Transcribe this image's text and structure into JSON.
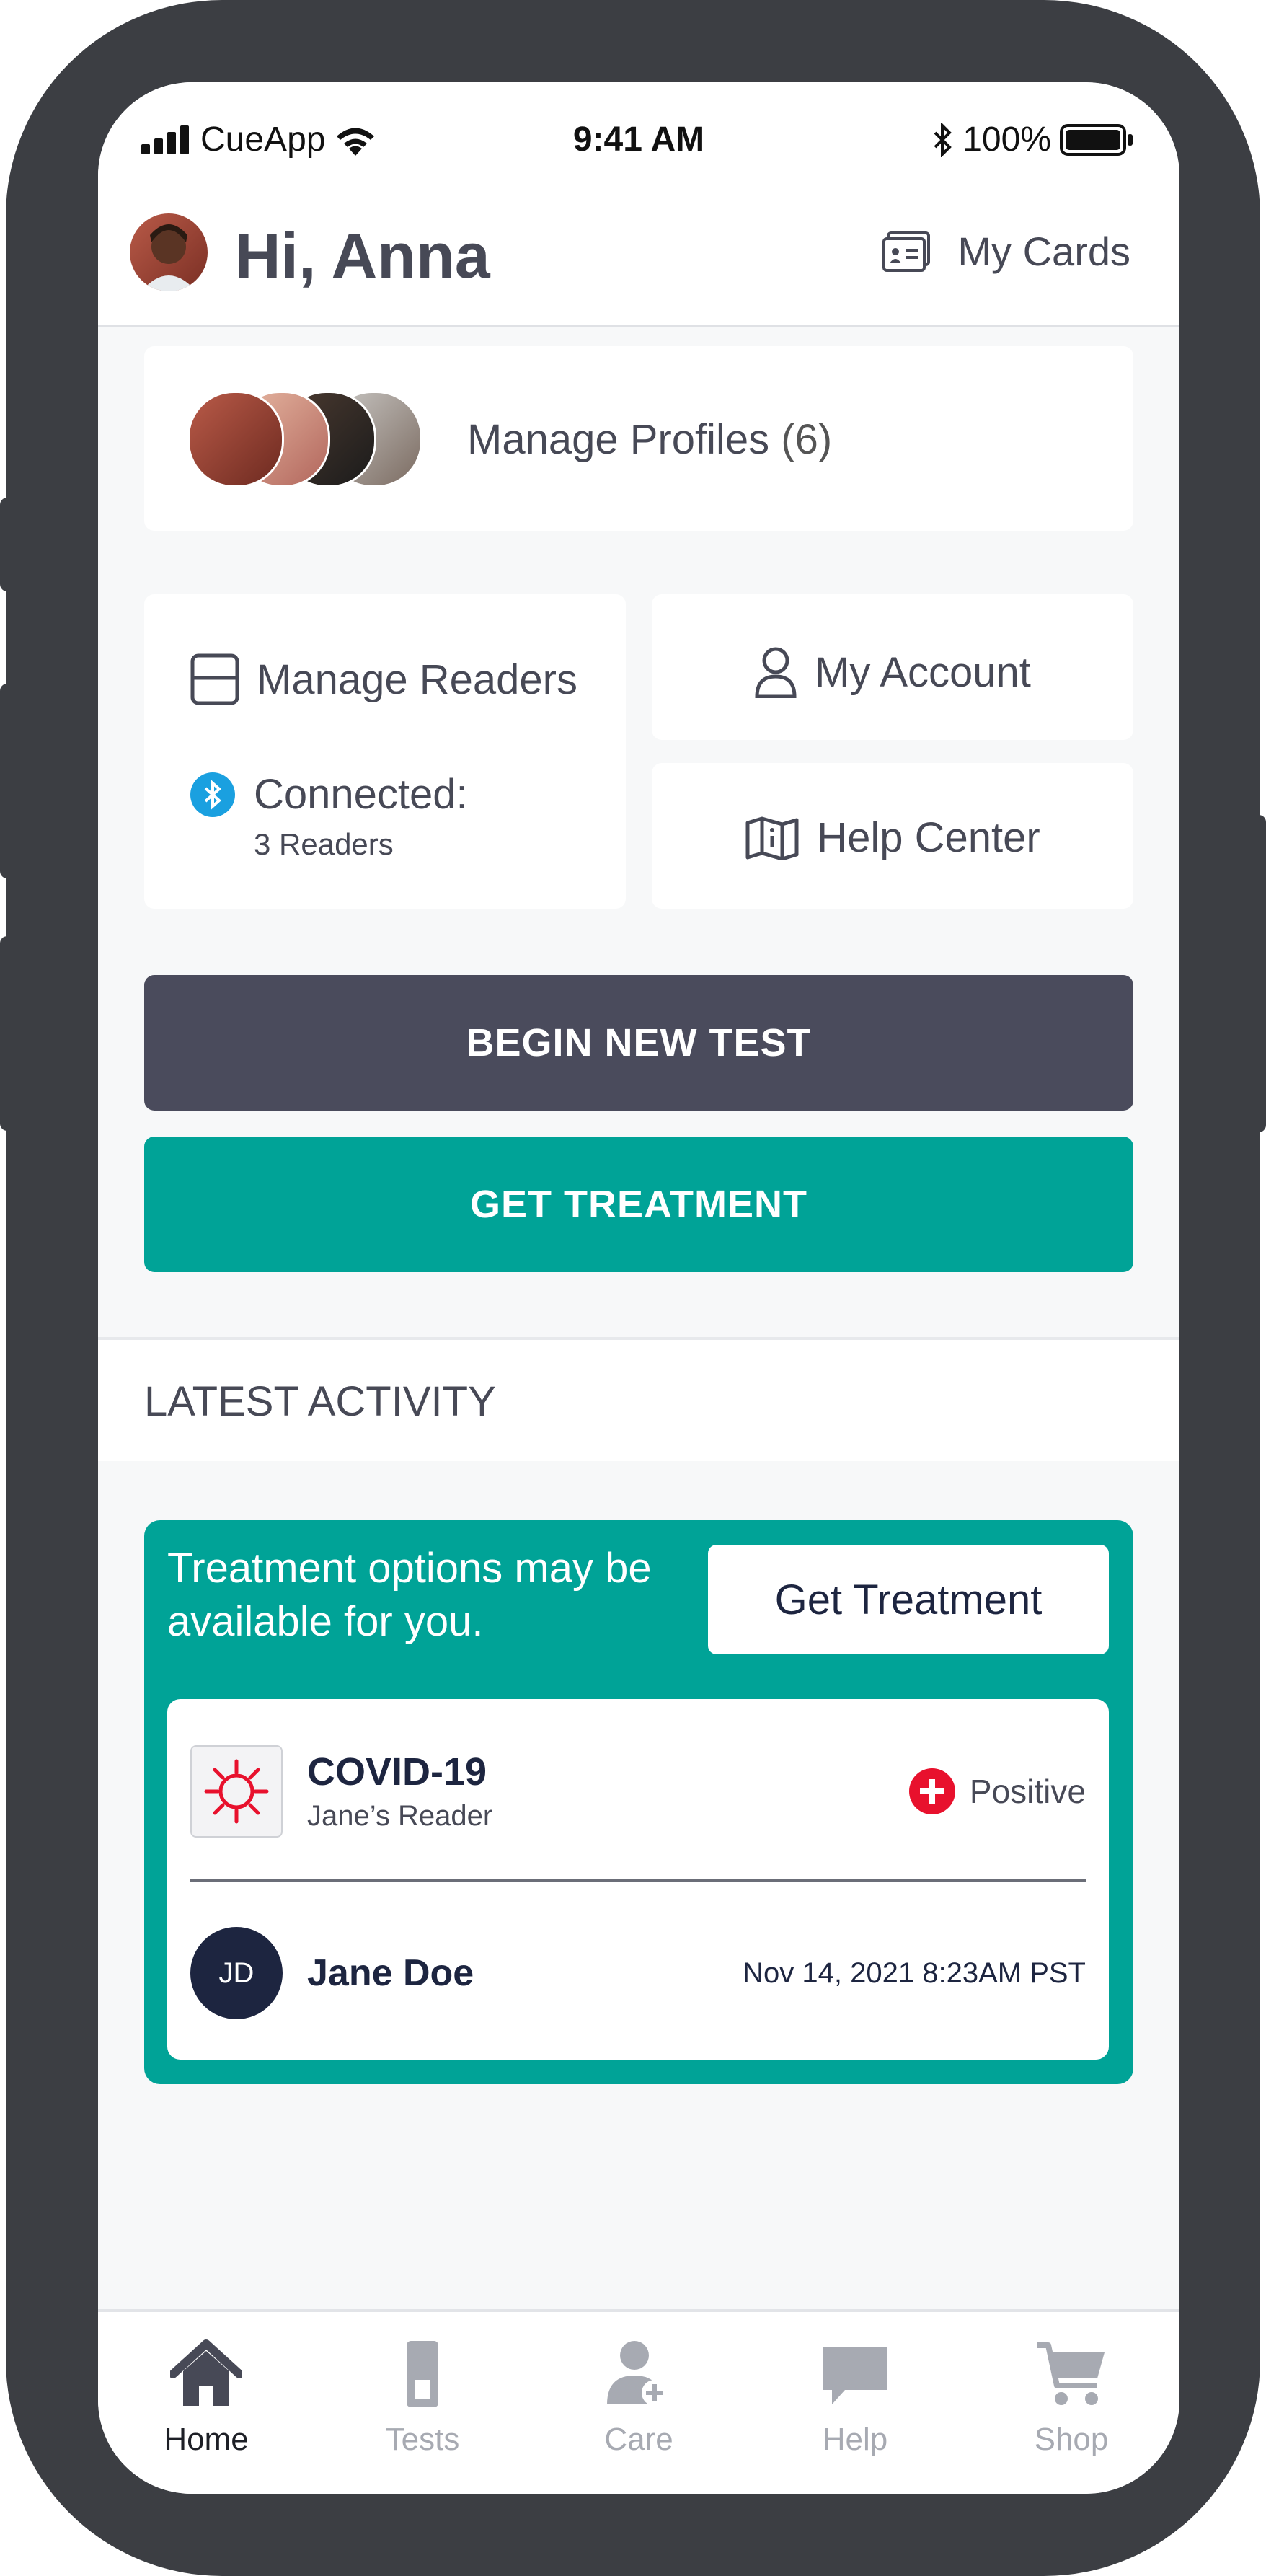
{
  "status_bar": {
    "carrier": "CueApp",
    "time": "9:41 AM",
    "battery": "100%"
  },
  "header": {
    "greeting": "Hi, Anna",
    "my_cards": "My Cards"
  },
  "profiles": {
    "label": "Manage Profiles",
    "count": "(6)"
  },
  "readers": {
    "label": "Manage Readers",
    "connected_label": "Connected:",
    "connected_count": "3 Readers"
  },
  "account": {
    "label": "My Account"
  },
  "help_center": {
    "label": "Help Center"
  },
  "actions": {
    "begin_test": "BEGIN NEW TEST",
    "get_treatment": "GET TREATMENT"
  },
  "activity": {
    "title": "LATEST ACTIVITY",
    "alert_text": "Treatment options may be available for you.",
    "alert_button": "Get Treatment",
    "result": {
      "test_name": "COVID-19",
      "reader": "Jane’s Reader",
      "status": "Positive",
      "initials": "JD",
      "person": "Jane Doe",
      "date": "Nov 14, 2021 8:23AM PST"
    }
  },
  "tabs": [
    {
      "label": "Home",
      "icon": "home-icon",
      "active": true
    },
    {
      "label": "Tests",
      "icon": "test-icon",
      "active": false
    },
    {
      "label": "Care",
      "icon": "care-icon",
      "active": false
    },
    {
      "label": "Help",
      "icon": "chat-icon",
      "active": false
    },
    {
      "label": "Shop",
      "icon": "cart-icon",
      "active": false
    }
  ],
  "colors": {
    "primary": "#4a4b5c",
    "accent": "#00a397",
    "danger": "#e8112d",
    "bluetooth": "#1aa0e0",
    "navy": "#1d2540"
  }
}
